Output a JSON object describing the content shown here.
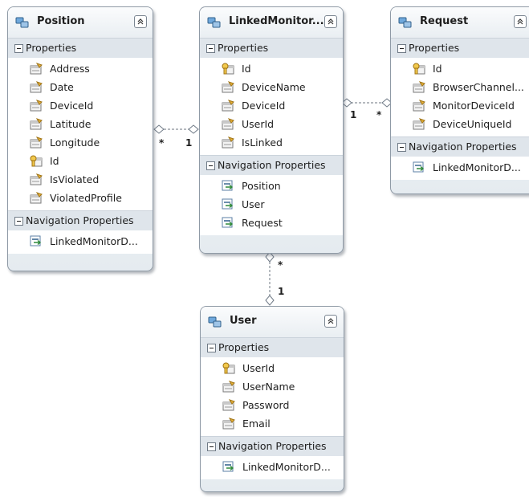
{
  "entities": {
    "position": {
      "title": "Position",
      "properties_label": "Properties",
      "properties": [
        "Address",
        "Date",
        "DeviceId",
        "Latitude",
        "Longitude",
        "Id",
        "IsViolated",
        "ViolatedProfile"
      ],
      "navigation_label": "Navigation Properties",
      "navigation": [
        "LinkedMonitorD..."
      ]
    },
    "linked_monitor": {
      "title": "LinkedMonitor...",
      "properties_label": "Properties",
      "properties": [
        "Id",
        "DeviceName",
        "DeviceId",
        "UserId",
        "IsLinked"
      ],
      "navigation_label": "Navigation Properties",
      "navigation": [
        "Position",
        "User",
        "Request"
      ]
    },
    "request": {
      "title": "Request",
      "properties_label": "Properties",
      "properties": [
        "Id",
        "BrowserChannel...",
        "MonitorDeviceId",
        "DeviceUniqueId"
      ],
      "navigation_label": "Navigation Properties",
      "navigation": [
        "LinkedMonitorD..."
      ]
    },
    "user": {
      "title": "User",
      "properties_label": "Properties",
      "properties": [
        "UserId",
        "UserName",
        "Password",
        "Email"
      ],
      "navigation_label": "Navigation Properties",
      "navigation": [
        "LinkedMonitorD..."
      ]
    }
  },
  "associations": {
    "position_linked": {
      "position_end": "*",
      "linked_end": "1"
    },
    "linked_request": {
      "linked_end": "1",
      "request_end": "*"
    },
    "linked_user": {
      "linked_end": "*",
      "user_end": "1"
    }
  },
  "icons": {
    "entity": "entity-icon",
    "property": "property-icon",
    "key_property": "key-property-icon",
    "navigation": "navigation-property-icon",
    "collapse": "collapse-chevron-icon"
  },
  "colors": {
    "entity_bg": "#e5ebf0",
    "border": "#8f9aa6",
    "section_bg": "#dfe5eb",
    "connector": "#8a9199"
  }
}
